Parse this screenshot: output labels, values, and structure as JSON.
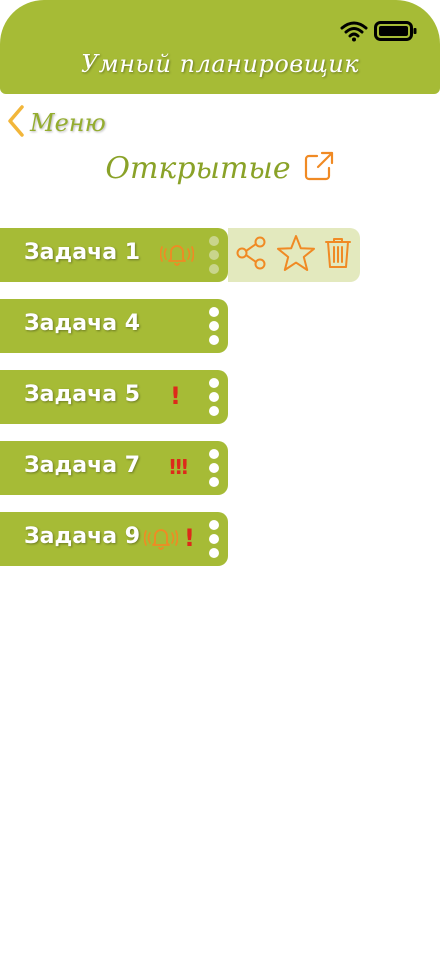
{
  "header": {
    "title": "Умный планировщик"
  },
  "nav": {
    "back_label": "Меню"
  },
  "section": {
    "title": "Открытые"
  },
  "tasks": [
    {
      "label": "Задача 1",
      "indicators": [
        "reminder-bell"
      ],
      "swiped": true
    },
    {
      "label": "Задача 4",
      "indicators": []
    },
    {
      "label": "Задача 5",
      "indicators": [
        "!"
      ]
    },
    {
      "label": "Задача 7",
      "indicators": [
        "!!!"
      ]
    },
    {
      "label": "Задача 9",
      "indicators": [
        "reminder-bell",
        "!"
      ]
    }
  ],
  "swipe_actions": [
    "share-icon",
    "star-icon",
    "trash-icon"
  ],
  "colors": {
    "accent": "#a6bb36",
    "icon_orange": "#f08a24",
    "priority_red": "#dd2a1a",
    "back_arrow": "#f2b63a"
  }
}
